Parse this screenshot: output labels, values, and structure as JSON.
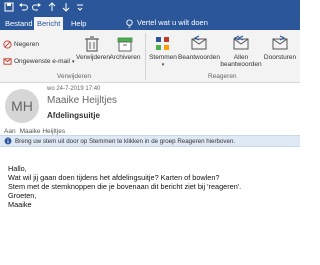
{
  "quick_access": {
    "save": "save-icon",
    "undo": "undo-icon",
    "redo": "redo-icon",
    "up": "up-arrow-icon",
    "down": "down-arrow-icon",
    "more": "customize-icon"
  },
  "tabs": [
    {
      "label": "Bestand",
      "active": false
    },
    {
      "label": "Bericht",
      "active": true
    },
    {
      "label": "Help",
      "active": false
    }
  ],
  "tell_me": "Vertel wat u wilt doen",
  "ribbon": {
    "ignore": "Negeren",
    "junk": "Ongewenste e-mail",
    "delete": "Verwijderen",
    "archive": "Archiveren",
    "group_delete": "Verwijderen",
    "vote": "Stemmen",
    "reply": "Beantwoorden",
    "reply_all_1": "Allen",
    "reply_all_2": "beantwoorden",
    "forward": "Doorsturen",
    "group_respond": "Reageren"
  },
  "message": {
    "avatar_initials": "MH",
    "date": "wo 24-7-2019 17:40",
    "sender": "Maaike Heijltjes",
    "subject": "Afdelingsuitje",
    "to_label": "Aan",
    "to_value": "Maaike Heijltjes",
    "info": "Breng uw stem uit door op Stemmen te klikken in de groep Reageren hierboven.",
    "body": [
      "Hallo,",
      "Wat wil jij gaan doen tijdens het afdelingsuitje? Karten of bowlen?",
      "Stem met de stemknoppen die je bovenaan dit bericht ziet bij 'reageren'.",
      "Groeten,",
      "Maaike"
    ]
  },
  "colors": {
    "titlebar": "#2b579a",
    "ribbon": "#f3f3f3",
    "infobar": "#dfe9f5"
  }
}
